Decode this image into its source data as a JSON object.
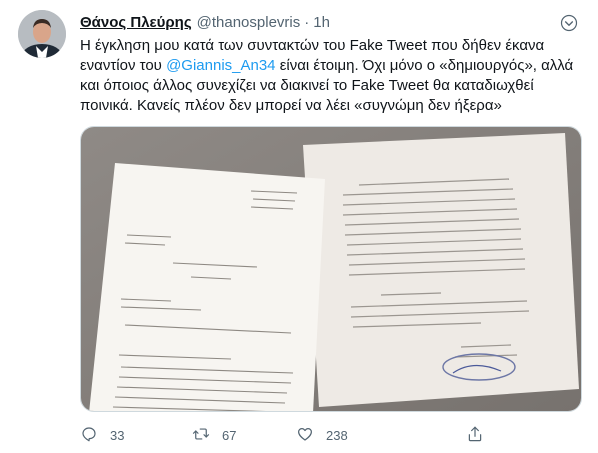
{
  "tweet": {
    "display_name": "Θάνος Πλεύρης",
    "handle": "@thanosplevris",
    "separator": "·",
    "time": "1h",
    "text_before_mention": "Η έγκληση μου κατά των συντακτών του Fake Tweet που δήθεν έκανα εναντίον του ",
    "mention": "@Giannis_An34",
    "text_after_mention": " είναι έτοιμη. Όχι μόνο ο «δημιουργός», αλλά και όποιος άλλος συνεχίζει να διακινεί το Fake Tweet θα καταδιωχθεί ποινικά. Κανείς πλέον δεν μπορεί να λέει «συγνώμη δεν ήξερα»",
    "media_alt": "Photo of two printed legal documents on a table",
    "icons": {
      "more": "more-icon",
      "reply": "reply-icon",
      "retweet": "retweet-icon",
      "like": "like-icon",
      "share": "share-icon"
    }
  },
  "actions": {
    "reply_count": "33",
    "retweet_count": "67",
    "like_count": "238"
  },
  "colors": {
    "accent": "#1d9bf0",
    "text": "#0f1419",
    "secondary": "#536471"
  }
}
